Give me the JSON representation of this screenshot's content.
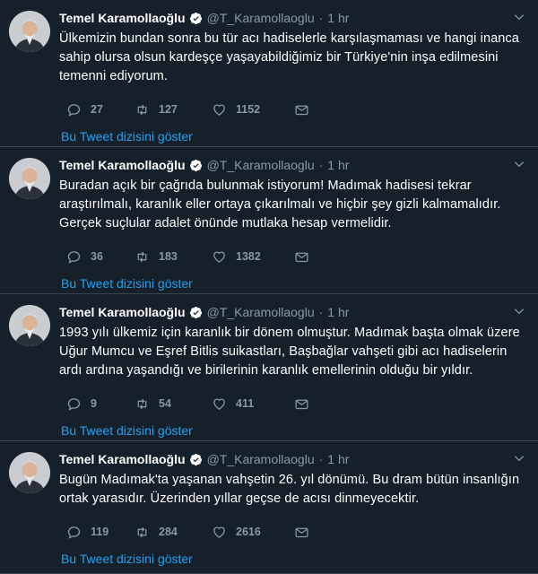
{
  "colors": {
    "accent": "#1da1f2",
    "muted": "#8899a6",
    "background": "#15202b",
    "divider": "#38444d"
  },
  "tweets": [
    {
      "name": "Temel Karamollaoğlu",
      "handle": "@T_Karamollaoglu",
      "time": "1 hr",
      "text": "Ülkemizin bundan sonra bu tür acı hadiselerle karşılaşmaması ve hangi inanca sahip olursa olsun kardeşçe yaşayabildiğimiz bir Türkiye'nin inşa edilmesini temenni ediyorum.",
      "replies": "27",
      "retweets": "127",
      "likes": "1152",
      "thread_link": "Bu Tweet dizisini göster"
    },
    {
      "name": "Temel Karamollaoğlu",
      "handle": "@T_Karamollaoglu",
      "time": "1 hr",
      "text": "Buradan açık bir çağrıda bulunmak istiyorum! Madımak hadisesi tekrar araştırılmalı, karanlık eller ortaya çıkarılmalı ve hiçbir şey gizli kalmamalıdır. Gerçek suçlular adalet önünde mutlaka hesap vermelidir.",
      "replies": "36",
      "retweets": "183",
      "likes": "1382",
      "thread_link": "Bu Tweet dizisini göster"
    },
    {
      "name": "Temel Karamollaoğlu",
      "handle": "@T_Karamollaoglu",
      "time": "1 hr",
      "text": "1993 yılı ülkemiz için karanlık bir dönem olmuştur. Madımak başta olmak üzere Uğur Mumcu ve Eşref Bitlis suikastları, Başbağlar vahşeti gibi acı hadiselerin ardı ardına yaşandığı ve birilerinin karanlık emellerinin olduğu bir yıldır.",
      "replies": "9",
      "retweets": "54",
      "likes": "411",
      "thread_link": "Bu Tweet dizisini göster"
    },
    {
      "name": "Temel Karamollaoğlu",
      "handle": "@T_Karamollaoglu",
      "time": "1 hr",
      "text": "Bugün Madımak'ta yaşanan vahşetin 26. yıl dönümü. Bu dram bütün insanlığın ortak yarasıdır. Üzerinden yıllar geçse de acısı dinmeyecektir.",
      "replies": "119",
      "retweets": "284",
      "likes": "2616",
      "thread_link": "Bu Tweet dizisini göster"
    }
  ]
}
